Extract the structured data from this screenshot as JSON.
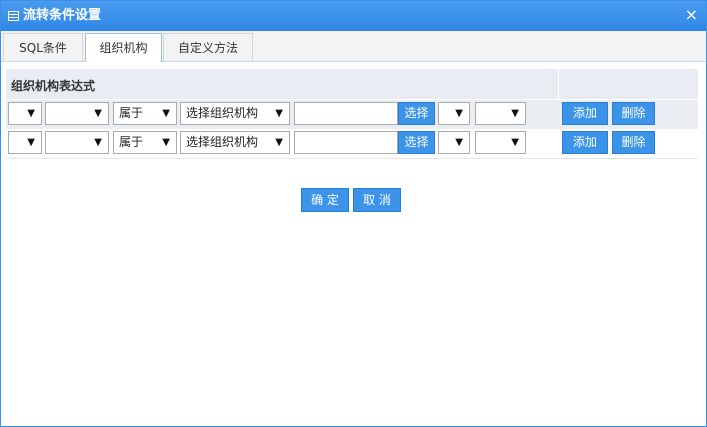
{
  "window": {
    "title": "流转条件设置",
    "close_symbol": "×"
  },
  "tabs": [
    {
      "label": "SQL条件"
    },
    {
      "label": "组织机构"
    },
    {
      "label": "自定义方法"
    }
  ],
  "grid": {
    "header": "组织机构表达式"
  },
  "rows": [
    {
      "relation": "属于",
      "org_select": "选择组织机构",
      "org_value": "",
      "select_btn": "选择",
      "add_btn": "添加",
      "delete_btn": "删除"
    },
    {
      "relation": "属于",
      "org_select": "选择组织机构",
      "org_value": "",
      "select_btn": "选择",
      "add_btn": "添加",
      "delete_btn": "删除"
    }
  ],
  "footer": {
    "ok": "确 定",
    "cancel": "取 消"
  },
  "icons": {
    "dropdown": "▼",
    "title_icon": "grid-icon"
  },
  "colors": {
    "accent": "#3b94e8",
    "titlebar": "#2f86e6"
  }
}
